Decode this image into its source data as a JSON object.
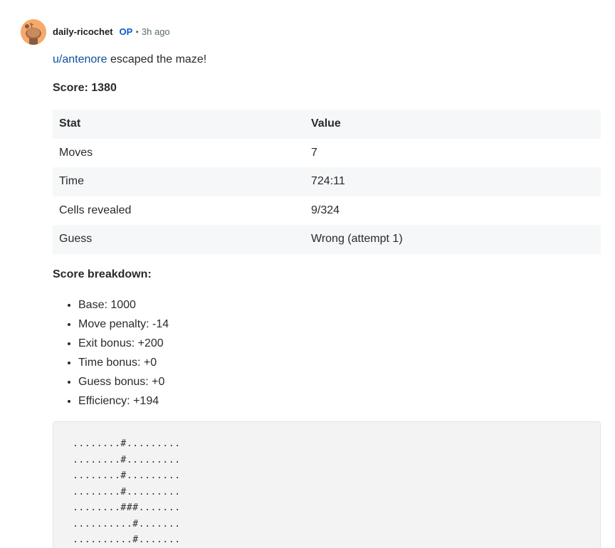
{
  "comment": {
    "author": "daily-ricochet",
    "op_label": "OP",
    "separator": "•",
    "timestamp": "3h ago",
    "intro_user": "u/antenore",
    "intro_text": " escaped the maze!",
    "score_line": "Score: 1380",
    "table": {
      "headers": [
        "Stat",
        "Value"
      ],
      "rows": [
        [
          "Moves",
          "7"
        ],
        [
          "Time",
          "724:11"
        ],
        [
          "Cells revealed",
          "9/324"
        ],
        [
          "Guess",
          "Wrong (attempt 1)"
        ]
      ]
    },
    "breakdown_title": "Score breakdown:",
    "breakdown": [
      "Base: 1000",
      "Move penalty: -14",
      "Exit bonus: +200",
      "Time bonus: +0",
      "Guess bonus: +0",
      "Efficiency: +194"
    ],
    "maze_lines": [
      "........#.........",
      "........#.........",
      "........#.........",
      "........#.........",
      "........###.......",
      "..........#.......",
      "..........#......."
    ]
  },
  "colors": {
    "avatar_bg": "#f6a96a",
    "op": "#0a5bd0",
    "link": "#0f4f9e"
  }
}
